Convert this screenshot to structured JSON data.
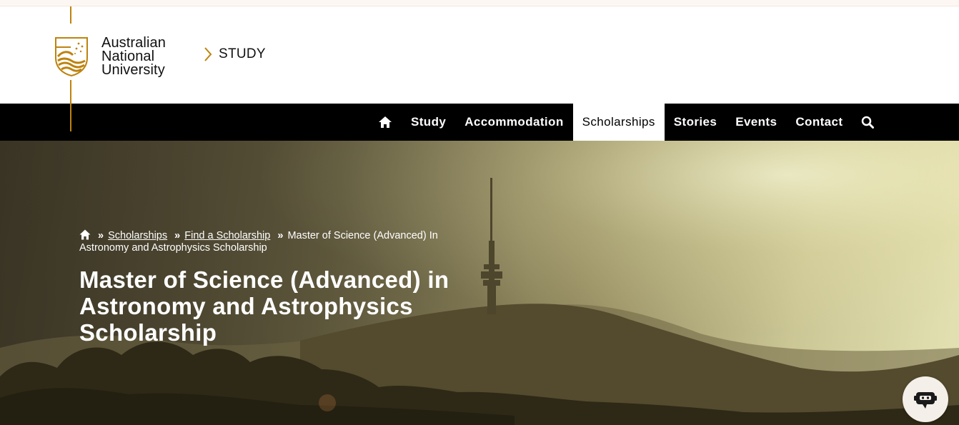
{
  "header": {
    "university_name_lines": [
      "Australian",
      "National",
      "University"
    ],
    "section_link": "STUDY"
  },
  "nav": {
    "items": [
      {
        "label": "Study"
      },
      {
        "label": "Accommodation"
      },
      {
        "label": "Scholarships",
        "active": true
      },
      {
        "label": "Stories"
      },
      {
        "label": "Events"
      },
      {
        "label": "Contact"
      }
    ],
    "icons": [
      "home-icon",
      "search-icon"
    ]
  },
  "breadcrumb": {
    "items": [
      "Scholarships",
      "Find a Scholarship"
    ],
    "current": "Master of Science (Advanced) In Astronomy and Astrophysics Scholarship"
  },
  "hero": {
    "title": "Master of Science (Advanced) in Astronomy and Astrophysics Scholarship"
  },
  "colors": {
    "brand_gold": "#be830e",
    "nav_background": "#000000",
    "top_strip": "#fdf7f3"
  },
  "chat": {
    "icon": "chatbot-icon"
  }
}
